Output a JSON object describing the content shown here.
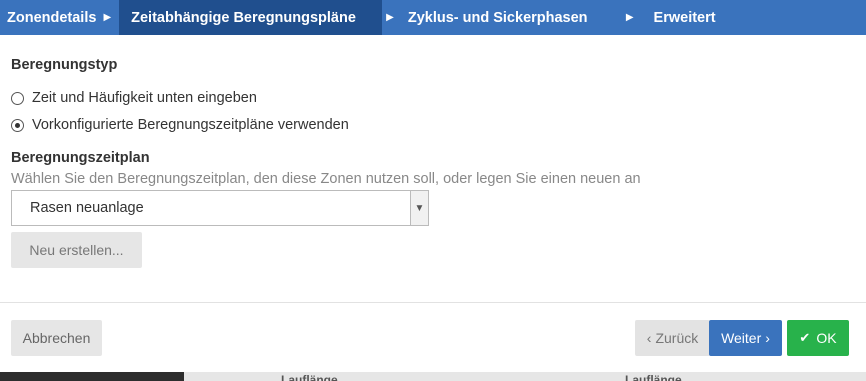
{
  "tabs": [
    {
      "label": "Zonendetails"
    },
    {
      "label": "Zeitabhängige Beregnungspläne"
    },
    {
      "label": "Zyklus- und Sickerphasen"
    },
    {
      "label": "Erweitert"
    }
  ],
  "form": {
    "section_type_label": "Beregnungstyp",
    "radio_manual_label": "Zeit und Häufigkeit unten eingeben",
    "radio_preset_label": "Vorkonfigurierte Beregnungszeitpläne verwenden",
    "selected_radio": "preset",
    "schedule_label": "Beregnungszeitplan",
    "schedule_hint": "Wählen Sie den Beregnungszeitplan, den diese Zonen nutzen soll, oder legen Sie einen neuen an",
    "schedule_value": "Rasen neuanlage",
    "new_button": "Neu erstellen..."
  },
  "footer": {
    "cancel": "Abbrechen",
    "back": "Zurück",
    "next": "Weiter",
    "ok": "OK"
  },
  "background": {
    "label_1": "Lauflänge",
    "label_2": "Lauflänge"
  },
  "colors": {
    "tabbar": "#3a73bd",
    "tab_active": "#204f8e",
    "primary": "#3a73bd",
    "success": "#28b24b"
  }
}
